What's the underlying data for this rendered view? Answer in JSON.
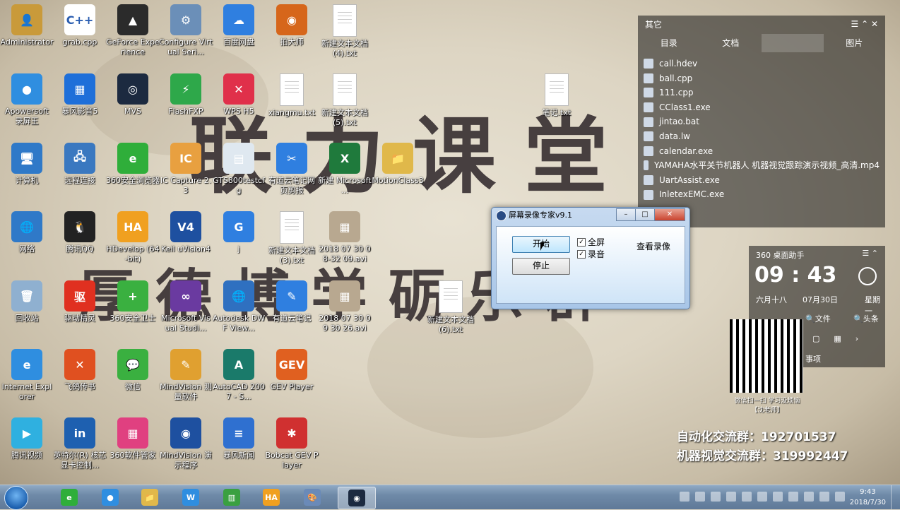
{
  "desktop_icons": [
    {
      "label": "Administrator",
      "color": "#c99a3a",
      "glyph": "👤"
    },
    {
      "label": "grab.cpp",
      "color": "#ffffff",
      "glyph": "C++"
    },
    {
      "label": "GeForce Experience",
      "color": "#2b2b2b",
      "glyph": "▲"
    },
    {
      "label": "Configure Virtual Seri...",
      "color": "#6b8fb8",
      "glyph": "⚙"
    },
    {
      "label": "百度网盘",
      "color": "#2f7fe0",
      "glyph": "☁"
    },
    {
      "label": "拍大师",
      "color": "#d6661b",
      "glyph": "◉"
    },
    {
      "label": "新建文本文档 (4).txt",
      "color": "#ffffff",
      "glyph": ""
    },
    {
      "label": "Apowersoft 录屏王",
      "color": "#2f8ee0",
      "glyph": "●"
    },
    {
      "label": "暴风影音5",
      "color": "#1e6fd9",
      "glyph": "▦"
    },
    {
      "label": "MVS",
      "color": "#1c2a40",
      "glyph": "◎"
    },
    {
      "label": "FlashFXP",
      "color": "#2ea84a",
      "glyph": "⚡"
    },
    {
      "label": "WPS H5",
      "color": "#e0304a",
      "glyph": "✕"
    },
    {
      "label": "xiangmu.txt",
      "color": "#ffffff",
      "glyph": ""
    },
    {
      "label": "新建文本文档 (5).txt",
      "color": "#ffffff",
      "glyph": ""
    },
    {
      "label": "笔记.txt",
      "color": "#ffffff",
      "glyph": ""
    },
    {
      "label": "计算机",
      "color": "#2f79c8",
      "glyph": "🖥"
    },
    {
      "label": "远程连接",
      "color": "#3a78c0",
      "glyph": "🖧"
    },
    {
      "label": "360安全浏览器",
      "color": "#2fae3a",
      "glyph": "e"
    },
    {
      "label": "IC Capture 2.3",
      "color": "#e8a040",
      "glyph": "IC"
    },
    {
      "label": "GTS800testcfg",
      "color": "#dfe8f0",
      "glyph": "▤"
    },
    {
      "label": "有道云笔记网页剪报",
      "color": "#2f7fe0",
      "glyph": "✂"
    },
    {
      "label": "新建 Microsoft ...",
      "color": "#1f7a3c",
      "glyph": "X"
    },
    {
      "label": "MotionClass3",
      "color": "#e0b84a",
      "glyph": "📁"
    },
    {
      "label": "网络",
      "color": "#2f79c8",
      "glyph": "🌐"
    },
    {
      "label": "腾讯QQ",
      "color": "#222222",
      "glyph": "🐧"
    },
    {
      "label": "HDevelop (64-bit)",
      "color": "#f0a020",
      "glyph": "HA"
    },
    {
      "label": "Keil uVision4",
      "color": "#1e50a0",
      "glyph": "V4"
    },
    {
      "label": "j",
      "color": "#2f7fe0",
      "glyph": "G"
    },
    {
      "label": "新建文本文档 (3).txt",
      "color": "#ffffff",
      "glyph": ""
    },
    {
      "label": "2018 07 30 08-32 09.avi",
      "color": "#b8a890",
      "glyph": "▦"
    },
    {
      "label": "回收站",
      "color": "#8fb0d0",
      "glyph": "🗑"
    },
    {
      "label": "驱动精灵",
      "color": "#e03020",
      "glyph": "驱"
    },
    {
      "label": "360安全卫士",
      "color": "#3ab040",
      "glyph": "+"
    },
    {
      "label": "Microsoft Visual Studi...",
      "color": "#6a3aa0",
      "glyph": "∞"
    },
    {
      "label": "Autodesk DWF View...",
      "color": "#2f70c0",
      "glyph": "🌐"
    },
    {
      "label": "有道云笔记",
      "color": "#2f7fe0",
      "glyph": "✎"
    },
    {
      "label": "2018 07 30 09 30 26.avi",
      "color": "#b8a890",
      "glyph": "▦"
    },
    {
      "label": "新建文本文档 (6).txt",
      "color": "#ffffff",
      "glyph": ""
    },
    {
      "label": "Internet Explorer",
      "color": "#2f8ee0",
      "glyph": "e"
    },
    {
      "label": "飞鸽传书",
      "color": "#e05020",
      "glyph": "✕"
    },
    {
      "label": "微信",
      "color": "#3ab040",
      "glyph": "💬"
    },
    {
      "label": "MindVision 测量软件",
      "color": "#e0a030",
      "glyph": "✎"
    },
    {
      "label": "AutoCAD 2007 - S...",
      "color": "#1a7a6a",
      "glyph": "A"
    },
    {
      "label": "GEV Player",
      "color": "#e06020",
      "glyph": "GEV"
    },
    {
      "label": "腾讯视频",
      "color": "#2fb0e0",
      "glyph": "▶"
    },
    {
      "label": "英特尔(R) 核芯显卡控制...",
      "color": "#1e60b0",
      "glyph": "in"
    },
    {
      "label": "360软件管家",
      "color": "#e04080",
      "glyph": "▦"
    },
    {
      "label": "MindVision 演示程序",
      "color": "#1e50a0",
      "glyph": "◉"
    },
    {
      "label": "暴风新闻",
      "color": "#2f70d0",
      "glyph": "≡"
    },
    {
      "label": "Bobcat GEV Player",
      "color": "#d03030",
      "glyph": "✱"
    }
  ],
  "watermark": {
    "line1": "联力课堂",
    "line2": "厚德博学砺乐群"
  },
  "side_panel": {
    "title": "其它",
    "tabs": [
      "目录",
      "文档",
      "",
      "图片"
    ],
    "files": [
      "call.hdev",
      "ball.cpp",
      "111.cpp",
      "CClass1.exe",
      "jintao.bat",
      "data.lw",
      "calendar.exe",
      "YAMAHA水平关节机器人 机器视觉跟踪演示视频_高清.mp4",
      "UartAssist.exe",
      "InletexEMC.exe"
    ]
  },
  "assistant": {
    "title": "360 桌面助手",
    "time": "09 : 43",
    "lunar": "六月十八",
    "date": "07月30日",
    "weekday": "星期一",
    "file_label": "文件",
    "head_label": "头条",
    "todo_label": "事项"
  },
  "qr_caption": "微信扫一扫 学习没烦恼",
  "qr_author": "【沈老师】",
  "promo": {
    "line1": "自动化交流群：192701537",
    "line2": "机器视觉交流群：319992447"
  },
  "dialog": {
    "title": "屏幕录像专家v9.1",
    "start_label": "开始",
    "stop_label": "停止",
    "fullscreen_label": "全屏",
    "audio_label": "录音",
    "view_label": "查看录像",
    "fullscreen_checked": true,
    "audio_checked": true
  },
  "taskbar": {
    "apps": [
      {
        "name": "360-browser",
        "glyph": "e",
        "color": "#2fae3a"
      },
      {
        "name": "apowersoft",
        "glyph": "●",
        "color": "#2f8ee0"
      },
      {
        "name": "explorer",
        "glyph": "📁",
        "color": "#e0b84a"
      },
      {
        "name": "wps",
        "glyph": "W",
        "color": "#2f8ee0"
      },
      {
        "name": "app-green",
        "glyph": "▥",
        "color": "#3aa040"
      },
      {
        "name": "hdevelop",
        "glyph": "HA",
        "color": "#f0a020"
      },
      {
        "name": "paint",
        "glyph": "🎨",
        "color": "#6a8ab8"
      },
      {
        "name": "screen-recorder",
        "glyph": "◉",
        "color": "#1c2a40"
      }
    ],
    "clock_time": "9:43",
    "clock_date": "2018/7/30"
  }
}
